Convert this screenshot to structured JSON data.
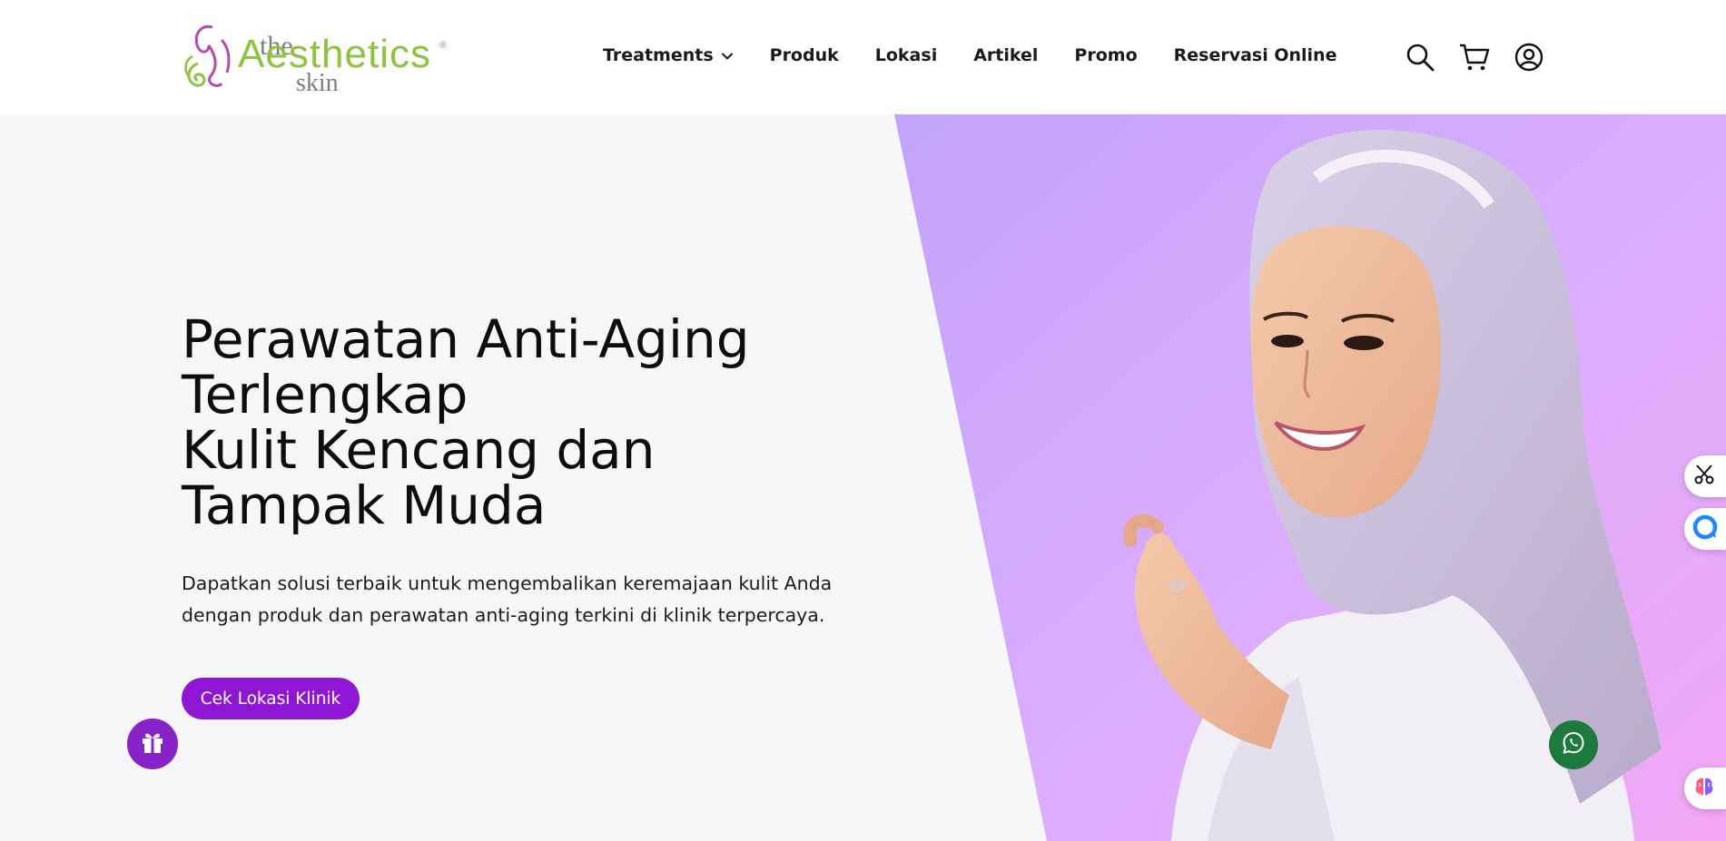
{
  "brand": {
    "logo_the": "the",
    "logo_name": "Aesthetics",
    "logo_reg": "®",
    "logo_skin": "skin",
    "green": "#8fc23e",
    "purple": "#8e16d4"
  },
  "nav": {
    "items": [
      {
        "label": "Treatments",
        "has_dropdown": true
      },
      {
        "label": "Produk"
      },
      {
        "label": "Lokasi"
      },
      {
        "label": "Artikel"
      },
      {
        "label": "Promo"
      },
      {
        "label": "Reservasi Online"
      }
    ]
  },
  "header_icons": [
    "search-icon",
    "cart-icon",
    "user-account-icon"
  ],
  "hero": {
    "title_lines": [
      "Perawatan Anti-Aging",
      "Terlengkap",
      "Kulit Kencang dan",
      "Tampak Muda"
    ],
    "description_lines": [
      "Dapatkan solusi terbaik untuk mengembalikan keremajaan kulit Anda",
      "dengan produk dan perawatan anti-aging terkini di klinik terpercaya."
    ],
    "cta_label": "Cek Lokasi Klinik",
    "image_alt": "Woman in lavender hijab and white blazer smiling on purple-pink gradient background"
  },
  "floating": {
    "gift_icon": "gift-icon",
    "whatsapp_icon": "whatsapp-icon",
    "side_widgets": [
      "scissors-icon",
      "chat-bubble-icon",
      "brain-icon"
    ],
    "gift_color": "#8a22c9",
    "whatsapp_color": "#1b7a3c"
  }
}
